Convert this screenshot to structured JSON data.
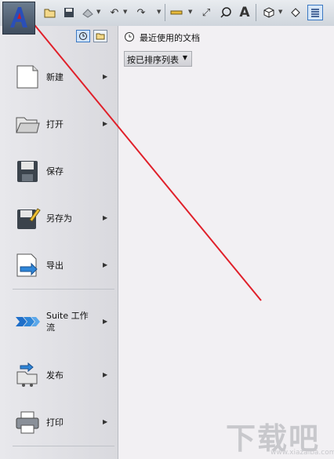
{
  "toolbar": {
    "icons": [
      "open-icon",
      "save-icon",
      "cloud-icon",
      "undo-icon",
      "redo-icon",
      "measure-icon",
      "dimension-icon",
      "tag-icon",
      "text-icon",
      "view-3d-icon",
      "section-icon",
      "thin-lines-icon"
    ],
    "text_glyph": "A"
  },
  "menu": {
    "items": [
      {
        "label": "新建",
        "has_submenu": true
      },
      {
        "label": "打开",
        "has_submenu": true
      },
      {
        "label": "保存",
        "has_submenu": false
      },
      {
        "label": "另存为",
        "has_submenu": true
      },
      {
        "label": "导出",
        "has_submenu": true
      },
      {
        "label_line1": "Suite 工作",
        "label_line2": "流",
        "has_submenu": true
      },
      {
        "label": "发布",
        "has_submenu": true
      },
      {
        "label": "打印",
        "has_submenu": true
      }
    ]
  },
  "recent": {
    "title": "最近使用的文档",
    "sort_label": "按已排序列表"
  },
  "watermark": {
    "text": "下载吧",
    "url": "www.xiazaiba.com"
  },
  "colors": {
    "annotation_arrow": "#e0202a",
    "accent": "#3a78c2"
  }
}
